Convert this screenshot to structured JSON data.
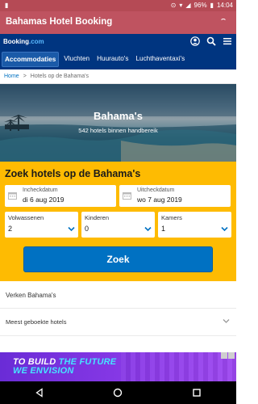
{
  "status_bar": {
    "battery": "96%",
    "time": "14:04"
  },
  "app_bar": {
    "title": "Bahamas Hotel Booking"
  },
  "booking_header": {
    "logo_text": "Booking",
    "logo_suffix": ".com",
    "icons": [
      "account-icon",
      "search-icon",
      "menu-icon"
    ],
    "tabs": [
      {
        "label": "Accommodaties",
        "active": true
      },
      {
        "label": "Vluchten",
        "active": false
      },
      {
        "label": "Huurauto's",
        "active": false
      },
      {
        "label": "Luchthaventaxi's",
        "active": false
      }
    ]
  },
  "breadcrumb": {
    "home": "Home",
    "separator": ">",
    "current": "Hotels op de Bahama's"
  },
  "hero": {
    "title": "Bahama's",
    "subtitle": "542 hotels binnen handbereik"
  },
  "search": {
    "title": "Zoek hotels op de Bahama's",
    "checkin": {
      "label": "Incheckdatum",
      "value": "di 6 aug 2019"
    },
    "checkout": {
      "label": "Uitcheckdatum",
      "value": "wo 7 aug 2019"
    },
    "adults": {
      "label": "Volwassenen",
      "value": "2"
    },
    "children": {
      "label": "Kinderen",
      "value": "0"
    },
    "rooms": {
      "label": "Kamers",
      "value": "1"
    },
    "button_label": "Zoek"
  },
  "sections": {
    "explore": "Verken Bahama's",
    "popular": "Meest geboekte hotels"
  },
  "ad": {
    "line1_prefix": "TO BUILD ",
    "line1_highlight": "THE FUTURE",
    "line2_highlight": "WE ENVISION"
  },
  "colors": {
    "app_bar": "#bf5360",
    "booking_blue": "#003580",
    "search_yellow": "#febb02",
    "button_blue": "#0071c2",
    "ad_purple": "#7b33e0"
  }
}
